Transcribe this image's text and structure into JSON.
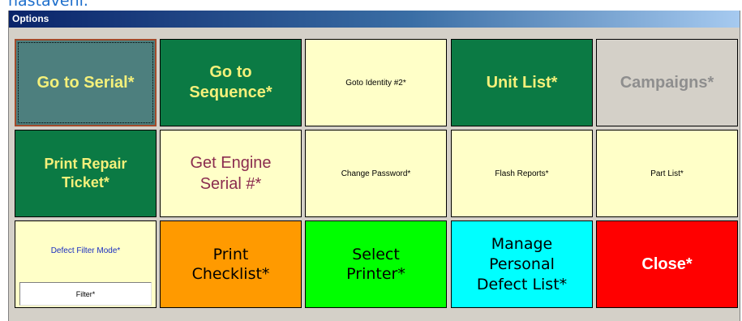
{
  "top_caption": "nastavení.",
  "window": {
    "title": "Options"
  },
  "tiles": {
    "go_to_serial": "Go to Serial*",
    "go_to_sequence": [
      "Go to",
      "Sequence*"
    ],
    "goto_identity": "Goto Identity #2*",
    "unit_list": "Unit List*",
    "campaigns": "Campaigns*",
    "print_repair_ticket": [
      "Print Repair",
      "Ticket*"
    ],
    "get_engine_serial": [
      "Get Engine",
      "Serial #*"
    ],
    "change_password": "Change Password*",
    "flash_reports": "Flash Reports*",
    "part_list": "Part List*",
    "defect_filter_mode": "Defect Filter Mode*",
    "filter": "Filter*",
    "print_checklist": [
      "Print",
      "Checklist*"
    ],
    "select_printer": [
      "Select",
      "Printer*"
    ],
    "manage_defect_list": [
      "Manage",
      "Personal",
      "Defect List*"
    ],
    "close": "Close*"
  },
  "colors": {
    "dark_green": "#0b7a44",
    "teal": "#4d7f7e",
    "cream": "#ffffc8",
    "orange": "#ff9a00",
    "lime": "#00ff00",
    "cyan": "#00ffff",
    "red": "#ff0000",
    "yellow_text": "#f4f07a"
  }
}
